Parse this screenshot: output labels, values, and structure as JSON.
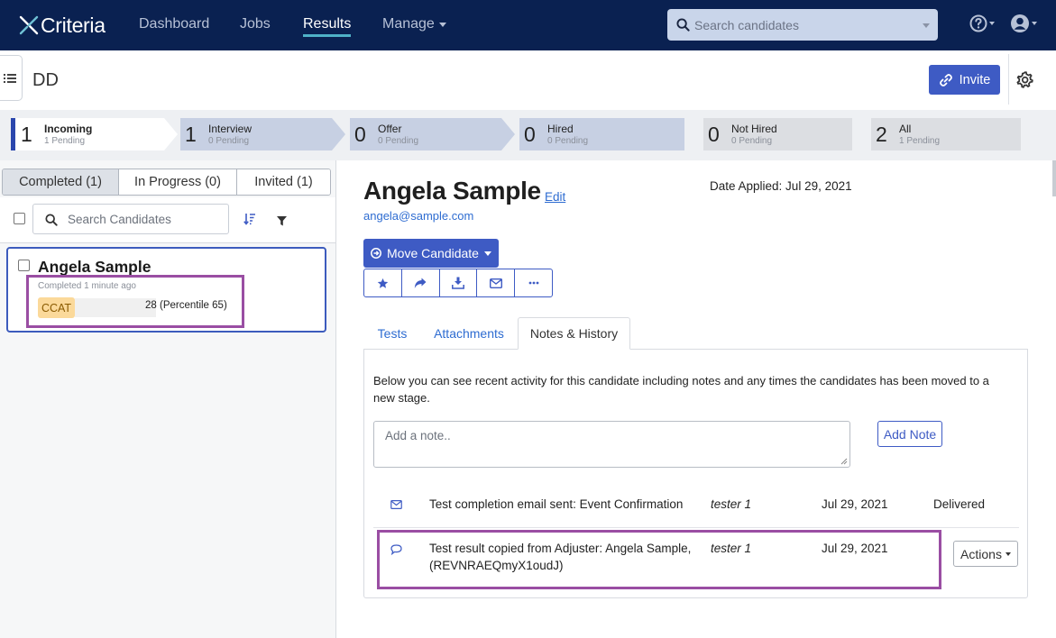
{
  "brand": {
    "name": "Criteria"
  },
  "nav": {
    "items": [
      {
        "label": "Dashboard",
        "active": false
      },
      {
        "label": "Jobs",
        "active": false
      },
      {
        "label": "Results",
        "active": true
      },
      {
        "label": "Manage",
        "active": false
      }
    ],
    "search_placeholder": "Search candidates"
  },
  "header": {
    "title": "DD",
    "invite_label": "Invite"
  },
  "stages": [
    {
      "count": "1",
      "name": "Incoming",
      "pending": "1 Pending"
    },
    {
      "count": "1",
      "name": "Interview",
      "pending": "0 Pending"
    },
    {
      "count": "0",
      "name": "Offer",
      "pending": "0 Pending"
    },
    {
      "count": "0",
      "name": "Hired",
      "pending": "0 Pending"
    },
    {
      "count": "0",
      "name": "Not Hired",
      "pending": "0 Pending"
    },
    {
      "count": "2",
      "name": "All",
      "pending": "1 Pending"
    }
  ],
  "left": {
    "tabs": [
      "Completed (1)",
      "In Progress (0)",
      "Invited (1)"
    ],
    "search_placeholder": "Search Candidates",
    "candidate": {
      "name": "Angela Sample",
      "status": "Completed 1 minute ago",
      "test": "CCAT",
      "score": "28 (Percentile 65)"
    }
  },
  "detail": {
    "name": "Angela Sample",
    "edit_label": "Edit",
    "email": "angela@sample.com",
    "date_applied": "Date Applied: Jul 29, 2021",
    "move_label": "Move Candidate",
    "tabs": [
      "Tests",
      "Attachments",
      "Notes & History"
    ],
    "description": "Below you can see recent activity for this candidate including notes and any times the candidates has been moved to a new stage.",
    "note_placeholder": "Add a note..",
    "add_note_label": "Add Note",
    "history": [
      {
        "text": "Test completion email sent: Event Confirmation",
        "by": "tester 1",
        "date": "Jul 29, 2021",
        "status": "Delivered"
      },
      {
        "text_line1": "Test result copied from Adjuster: Angela Sample,",
        "text_line2": "(REVNRAEQmyX1oudJ)",
        "by": "tester 1",
        "date": "Jul 29, 2021",
        "action": "Actions"
      }
    ]
  },
  "colors": {
    "nav_bg": "#0a2151",
    "primary": "#3e5bc4",
    "highlight": "#9a4ea3",
    "badge": "#fbd99a"
  }
}
